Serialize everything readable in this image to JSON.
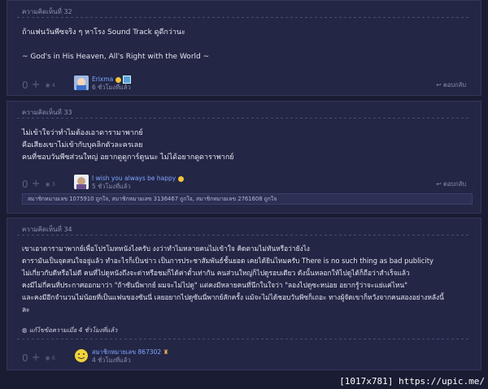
{
  "comments": [
    {
      "number": "ความคิดเห็นที่ 32",
      "lines": [
        "ถ้าแฟนวันพีซจริง ๆ หาโรง Sound Track ดูดีกว่านะ",
        "",
        "~ God's in His Heaven, All's Right with the World ~"
      ],
      "votes": {
        "plus": "0",
        "emoji_count": "4"
      },
      "user": {
        "name": "Erixma",
        "time": "6 ชั่วโมงที่แล้ว"
      },
      "reply": "ตอบกลับ"
    },
    {
      "number": "ความคิดเห็นที่ 33",
      "lines": [
        "ไม่เข้าใจว่าทำไมต้องเอาดารามาพากย์",
        "คือเสียงเขาไม่เข้ากับบุคลิกตัวละครเลย",
        "คนที่ชอบวันพีซส่วนใหญ่ อยากดูดูการ์ตูนนะ ไม่ได้อยากดูดาราพากย์"
      ],
      "votes": {
        "plus": "0",
        "emoji_count": "3"
      },
      "user": {
        "name": "I wish you always be happy",
        "time": "5 ชั่วโมงที่แล้ว"
      },
      "reply": "ตอบกลับ",
      "likes": "สมาชิกหมายเลข 1075910 ถูกใจ, สมาชิกหมายเลข 3136467 ถูกใจ, สมาชิกหมายเลข 2761608 ถูกใจ"
    },
    {
      "number": "ความคิดเห็นที่ 34",
      "lines": [
        "เขาเอาดารามาพากย์เพื่อโปรโมทหนังไงครับ งงว่าทำไมหลายคนไม่เข้าใจ คิดตามไม่ทันหรือว่ายังไง",
        "ดารามันเป็นจุดสนใจอยู่แล้ว ทำอะไรก็เป็นข่าว เป็นการประชาสัมพันธ์ชั้นยอด เคยได้ยินไหมครับ There is no such thing as bad publicity",
        "ไม่เกี่ยวกับดีหรือไม่ดี คนที่ไปดูหนังถึงจะด่าหรือชมก็ได้ค่าตั๋วเท่ากัน คนส่วนใหญ่ก็ไปดูรอบเดียว ดังนั้นหลอกให้ไปดูได้ก็ถือว่าสำเร็จแล้ว",
        "คงมีไม่กี่คนที่ประกาศออกมาว่า \"ถ้าซันนี่พากย์ ผมจะไม่ไปดู\" แต่คงมีหลายคนที่นึกในใจว่า \"ลองไปดูซะหน่อย อยากรู้ว่าจะแย่แค่ไหน\"",
        "และคงมีอีกจำนวนไม่น้อยที่เป็นแฟนของซันนี่ เลยอยากไปดูซันนี่พากย์สักครั้ง แม้จะไม่ได้ชอบวันพีซก็เถอะ ทางผู้จัดเขาก็หวังจากคนสองอย่างหลังนี้",
        "ละ"
      ],
      "edited": "แก้ไขข้อความเมื่อ 4 ชั่วโมงที่แล้ว",
      "votes": {
        "plus": "0",
        "emoji_count": "6"
      },
      "user": {
        "name": "สมาชิกหมายเลข 867302",
        "time": "4 ชั่วโมงที่แล้ว"
      }
    }
  ],
  "watermark": "[1017x781] https://upic.me/"
}
